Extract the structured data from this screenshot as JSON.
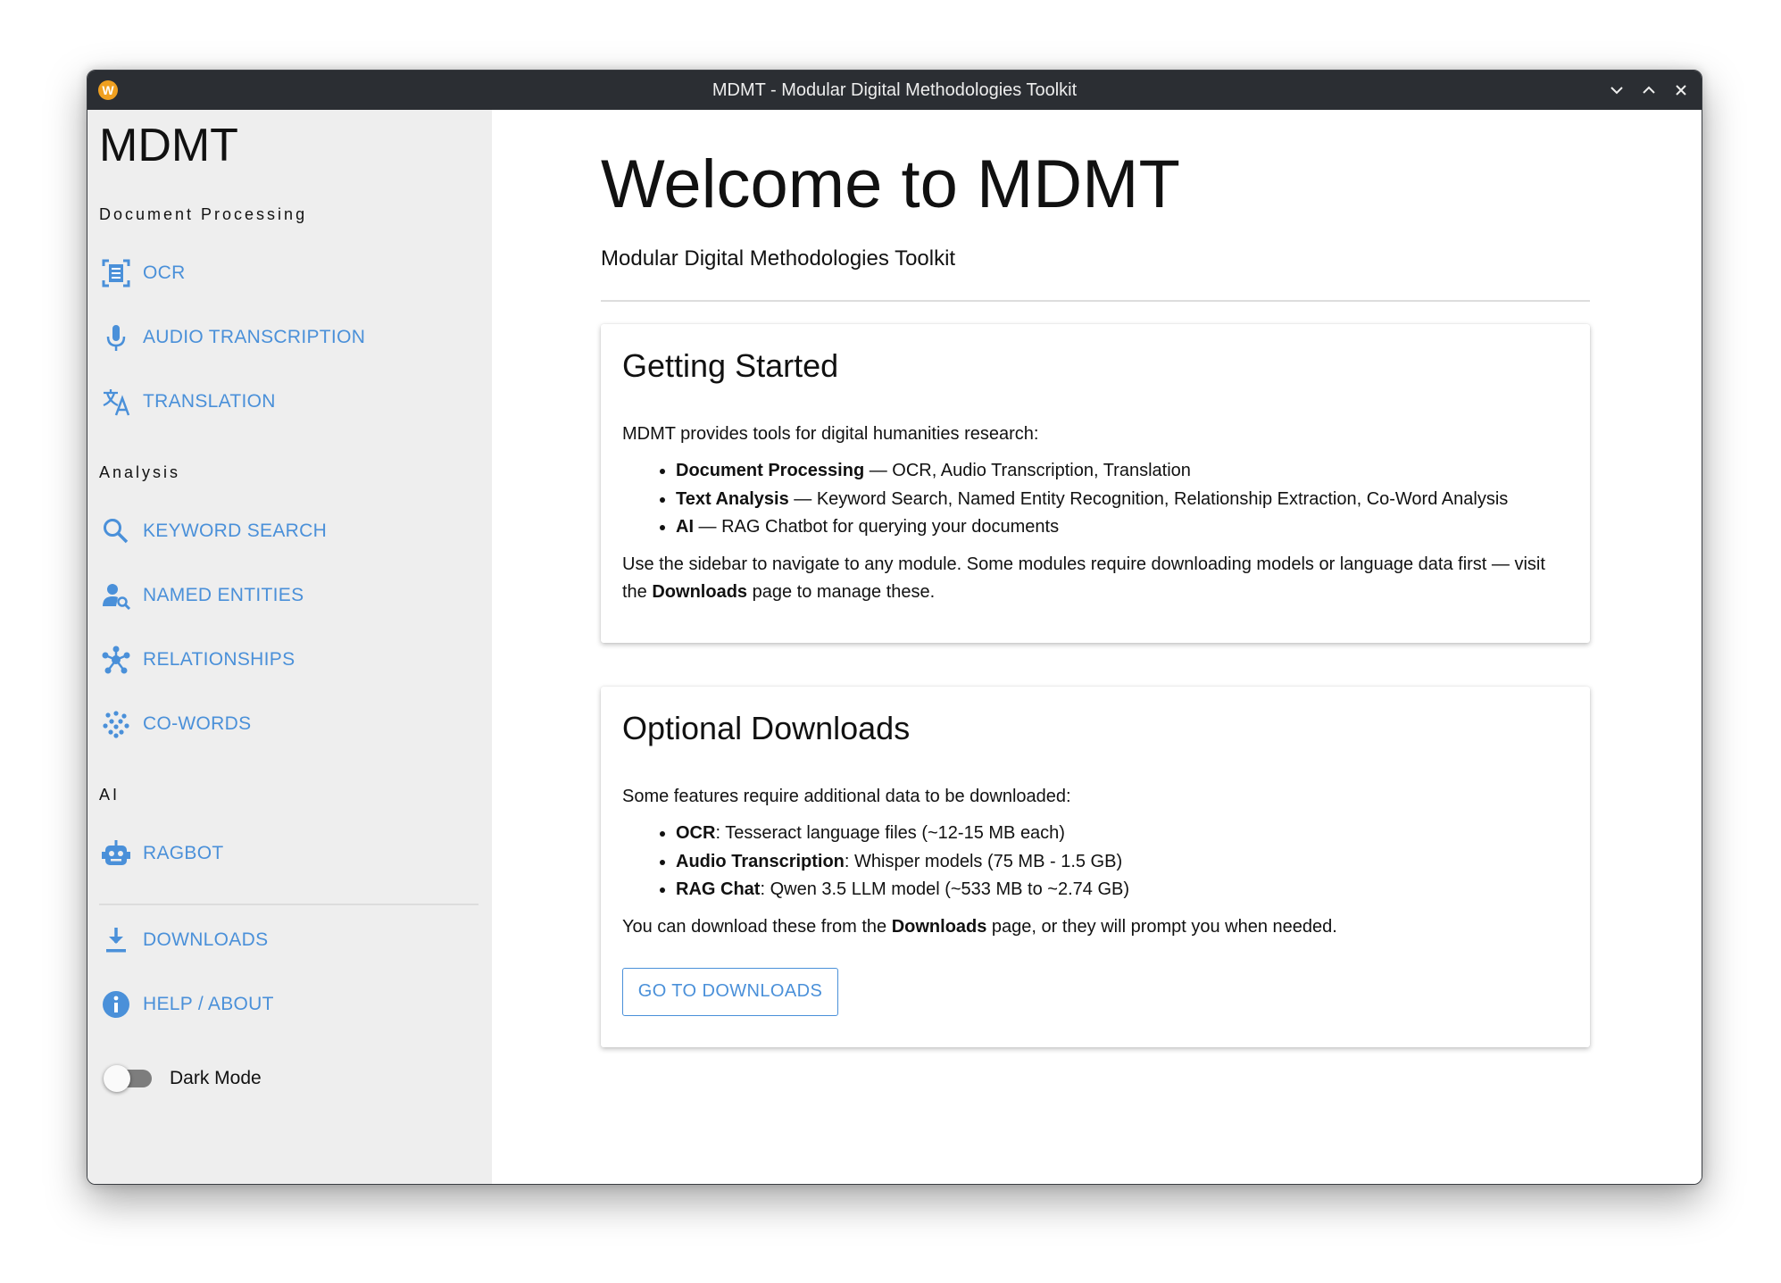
{
  "window": {
    "title": "MDMT - Modular Digital Methodologies Toolkit",
    "icon_letter": "W"
  },
  "sidebar": {
    "brand": "MDMT",
    "sections": {
      "doc": "Document Processing",
      "analysis": "Analysis",
      "ai": "AI"
    },
    "items": [
      {
        "label": "OCR",
        "icon": "document-scan-icon"
      },
      {
        "label": "AUDIO TRANSCRIPTION",
        "icon": "microphone-icon"
      },
      {
        "label": "TRANSLATION",
        "icon": "translate-icon"
      },
      {
        "label": "KEYWORD SEARCH",
        "icon": "search-icon"
      },
      {
        "label": "NAMED ENTITIES",
        "icon": "person-search-icon"
      },
      {
        "label": "RELATIONSHIPS",
        "icon": "network-icon"
      },
      {
        "label": "CO-WORDS",
        "icon": "dots-grid-icon"
      },
      {
        "label": "RAGBOT",
        "icon": "robot-icon"
      },
      {
        "label": "DOWNLOADS",
        "icon": "download-icon"
      },
      {
        "label": "HELP / ABOUT",
        "icon": "info-icon"
      }
    ],
    "dark_mode_label": "Dark Mode",
    "dark_mode_on": false
  },
  "main": {
    "title": "Welcome to MDMT",
    "subtitle": "Modular Digital Methodologies Toolkit",
    "getting_started": {
      "heading": "Getting Started",
      "intro": "MDMT provides tools for digital humanities research:",
      "bullets": [
        {
          "bold": "Document Processing",
          "text": " — OCR, Audio Transcription, Translation"
        },
        {
          "bold": "Text Analysis",
          "text": " — Keyword Search, Named Entity Recognition, Relationship Extraction, Co-Word Analysis"
        },
        {
          "bold": "AI",
          "text": " — RAG Chatbot for querying your documents"
        }
      ],
      "outro_pre": "Use the sidebar to navigate to any module. Some modules require downloading models or language data first — visit the ",
      "outro_bold": "Downloads",
      "outro_post": " page to manage these."
    },
    "optional_downloads": {
      "heading": "Optional Downloads",
      "intro": "Some features require additional data to be downloaded:",
      "bullets": [
        {
          "bold": "OCR",
          "text": ": Tesseract language files (~12-15 MB each)"
        },
        {
          "bold": "Audio Transcription",
          "text": ": Whisper models (75 MB - 1.5 GB)"
        },
        {
          "bold": "RAG Chat",
          "text": ": Qwen 3.5 LLM model (~533 MB to ~2.74 GB)"
        }
      ],
      "outro_pre": "You can download these from the ",
      "outro_bold": "Downloads",
      "outro_post": " page, or they will prompt you when needed.",
      "button": "GO TO DOWNLOADS"
    }
  },
  "colors": {
    "accent": "#4a90d9",
    "titlebar": "#2b2e33",
    "sidebar_bg": "#eeeeee"
  }
}
